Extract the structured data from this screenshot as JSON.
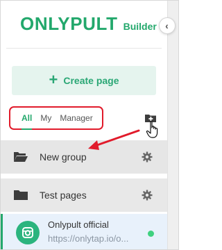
{
  "logo": {
    "main": "ONLYPULT",
    "sub": "Builder"
  },
  "create_button": {
    "label": "Create page"
  },
  "filter": {
    "tabs": [
      "All",
      "My",
      "Manager"
    ],
    "active": "All"
  },
  "groups": [
    {
      "label": "New group",
      "icon": "folder-open-icon"
    },
    {
      "label": "Test pages",
      "icon": "folder-icon"
    }
  ],
  "page_item": {
    "title": "Onlypult official",
    "url": "https://onlytap.io/o...",
    "status": "online"
  },
  "colors": {
    "accent": "#23a86c",
    "highlight": "#e11b2b",
    "create_bg": "#e5f4ee"
  },
  "icons": [
    "collapse-chevron-icon",
    "folder-add-icon",
    "hand-cursor-icon",
    "gear-icon",
    "camera-icon"
  ]
}
